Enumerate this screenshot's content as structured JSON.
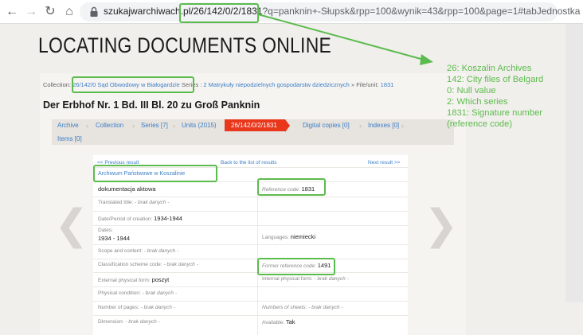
{
  "browser": {
    "url_host": "szukajwarchiwach.p",
    "url_highlight": "l/26/142/0/2/1831",
    "url_rest": "?q=panknin+-Słupsk&rpp=100&wynik=43&rpp=100&page=1#tabJednostka"
  },
  "slide": {
    "title": "LOCATING DOCUMENTS ONLINE",
    "annotation_lines": [
      "26: Koszalin Archives",
      "142: City files of Belgard",
      "0: Null value",
      "2: Which series",
      "1831: Signature number",
      "(reference code)"
    ]
  },
  "page": {
    "crumb_prefix": "Collection:",
    "crumb_collection": "26/142/0 Sąd Obwodowy w Białogardzie",
    "crumb_series_prefix": "Series :",
    "crumb_series": "2 Matrykuły niepodzielnych gospodarstw dziedzicznych",
    "crumb_unit_prefix": "» File/unit:",
    "crumb_unit": "1831",
    "doc_title": "Der Erbhof Nr. 1 Bd. III Bl. 20 zu Groß Panknin",
    "tabs": [
      "Archive",
      "Collection",
      "Series [7]",
      "Units (2015)",
      "26/142/0/2/1831",
      "Digital copies [0]",
      "Indexes [0]",
      "Items [0]"
    ],
    "prev_result": "<< Previous result",
    "back_list": "Back to the list of results",
    "next_result": "Next result >>",
    "archive_name": "Archiwum Państwowe w Koszalinie",
    "doc_type": "dokumentacja aktowa",
    "ref_code_label": "Reference code:",
    "ref_code": "1831",
    "translated_title_label": "Translated title:",
    "translated_title": "- brak danych -",
    "period_label": "Date/Period of creation:",
    "period": "1934-1944",
    "dates_label": "Dates:",
    "dates": "1934 - 1944",
    "languages_label": "Languages:",
    "languages": "niemiecki",
    "scope_label": "Scope and content:",
    "scope": "- brak danych -",
    "class_label": "Classification scheme code:",
    "class_val": "- brak danych -",
    "former_label": "Former reference code:",
    "former_val": "1491",
    "ext_form_label": "External physical form:",
    "ext_form": "poszyt",
    "int_form_label": "Internal physical form:",
    "int_form": "- brak danych -",
    "phys_cond_label": "Physical condition:",
    "phys_cond": "- brak danych -",
    "pages_label": "Number of pages:",
    "pages": "- brak danych -",
    "sheets_label": "Numbers of sheets:",
    "sheets": "- brak danych -",
    "dimension_label": "Dimension:",
    "dimension": "- brak danych -",
    "available_label": "Available:",
    "available": "Tak"
  },
  "colors": {
    "highlight": "#5cbb4e",
    "active_tab": "#e9371c",
    "link": "#3b7ec7"
  }
}
